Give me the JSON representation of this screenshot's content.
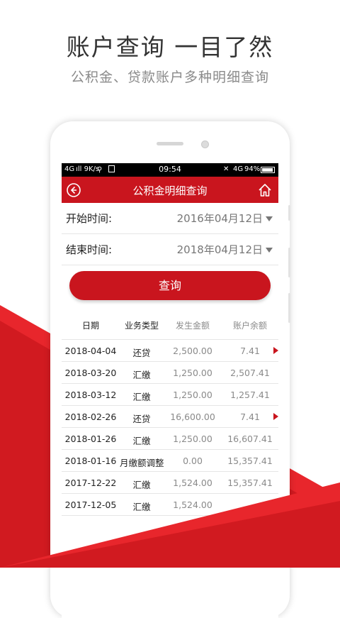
{
  "promo": {
    "headline": "账户查询 一目了然",
    "subheadline": "公积金、贷款账户多种明细查询"
  },
  "statusbar": {
    "left": "4G ıll  9K/s",
    "time": "09:54",
    "network": "4G",
    "battery": "94%"
  },
  "screen": {
    "title": "公积金明细查询",
    "back_icon": "back-arrow-icon",
    "home_icon": "home-icon"
  },
  "form": {
    "start_label": "开始时间:",
    "start_value": "2016年04月12日",
    "end_label": "结束时间:",
    "end_value": "2018年04月12日",
    "query_button": "查询"
  },
  "table": {
    "headers": [
      "日期",
      "业务类型",
      "发生金额",
      "账户余额"
    ],
    "rows": [
      {
        "date": "2018-04-04",
        "type": "还贷",
        "amount": "2,500.00",
        "balance": "7.41",
        "arrow": true
      },
      {
        "date": "2018-03-20",
        "type": "汇缴",
        "amount": "1,250.00",
        "balance": "2,507.41",
        "arrow": false
      },
      {
        "date": "2018-03-12",
        "type": "汇缴",
        "amount": "1,250.00",
        "balance": "1,257.41",
        "arrow": false
      },
      {
        "date": "2018-02-26",
        "type": "还贷",
        "amount": "16,600.00",
        "balance": "7.41",
        "arrow": true
      },
      {
        "date": "2018-01-26",
        "type": "汇缴",
        "amount": "1,250.00",
        "balance": "16,607.41",
        "arrow": false
      },
      {
        "date": "2018-01-16",
        "type": "月缴额调整",
        "amount": "0.00",
        "balance": "15,357.41",
        "arrow": false
      },
      {
        "date": "2017-12-22",
        "type": "汇缴",
        "amount": "1,524.00",
        "balance": "15,357.41",
        "arrow": false
      },
      {
        "date": "2017-12-05",
        "type": "汇缴",
        "amount": "1,524.00",
        "balance": "",
        "arrow": false
      }
    ]
  },
  "colors": {
    "accent": "#c9151e",
    "ribbon": "#e8262c"
  }
}
